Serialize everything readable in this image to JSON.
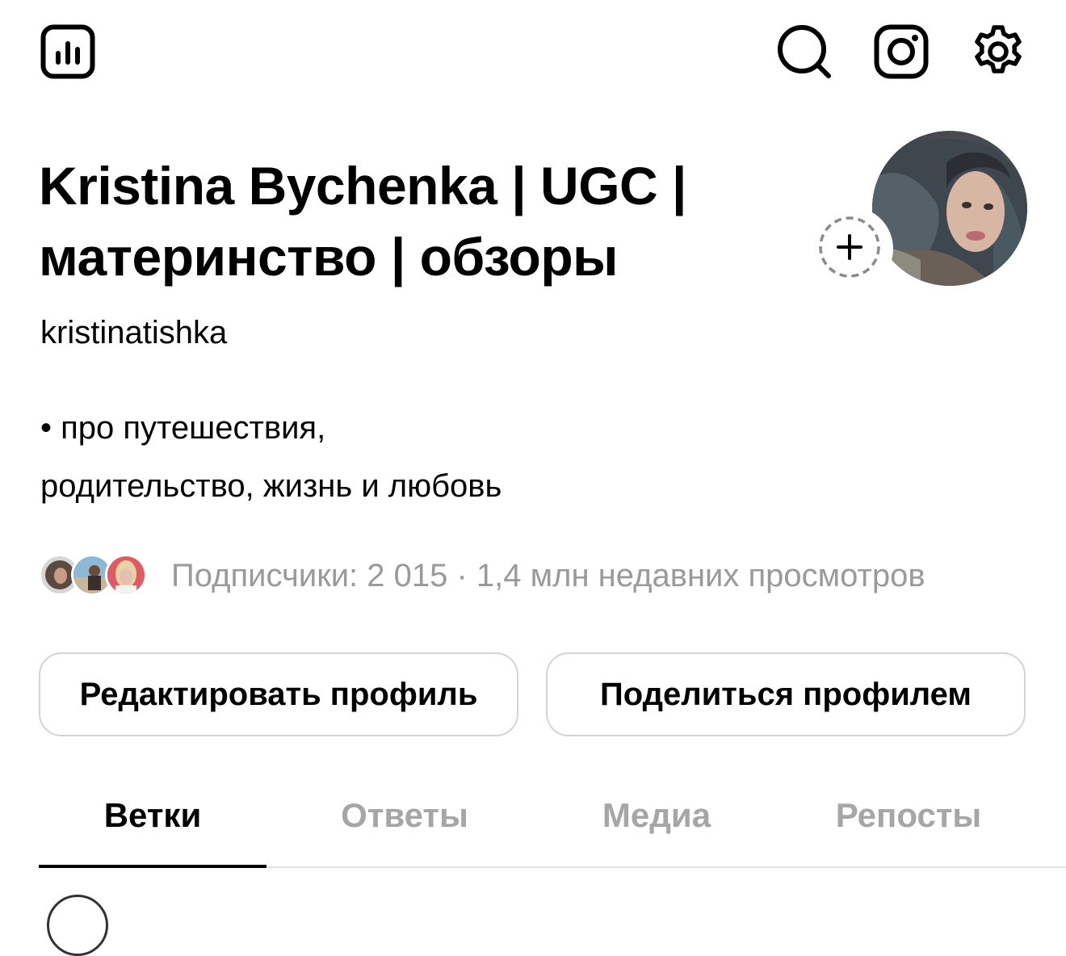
{
  "topbar": {
    "left_icon": "insights-chart-icon",
    "right_icons": [
      "search-icon",
      "instagram-icon",
      "settings-gear-icon"
    ]
  },
  "profile": {
    "name_line1": "Kristina Bychenka | UGC |",
    "name_line2": "материнство | обзоры",
    "username": "kristinatishka",
    "bio_line1": "• про путешествия,",
    "bio_line2": "родительство, жизнь и любовь",
    "avatar_icon": "profile-photo",
    "add_story_icon": "plus-icon"
  },
  "followers": {
    "text": "Подписчики: 2 015 · 1,4 млн недавних просмотров",
    "avatars": [
      "follower-avatar-1",
      "follower-avatar-2",
      "follower-avatar-3"
    ]
  },
  "actions": {
    "edit_label": "Редактировать профиль",
    "share_label": "Поделиться профилем"
  },
  "tabs": [
    {
      "label": "Ветки",
      "active": true
    },
    {
      "label": "Ответы",
      "active": false
    },
    {
      "label": "Медиа",
      "active": false
    },
    {
      "label": "Репосты",
      "active": false
    }
  ],
  "colors": {
    "text_primary": "#000000",
    "text_secondary": "#9a9a9a",
    "tab_inactive": "#a6a6a6",
    "button_border": "#d4d4d4",
    "divider": "#e2e2e2"
  }
}
